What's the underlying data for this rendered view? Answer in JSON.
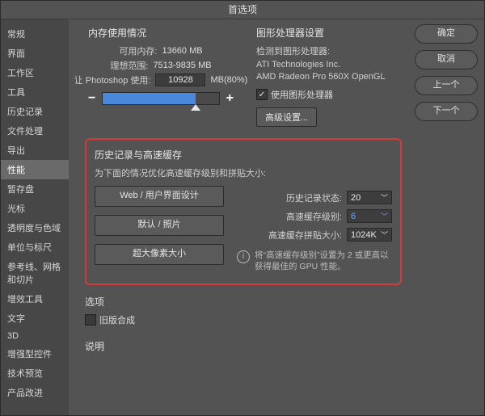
{
  "window": {
    "title": "首选项"
  },
  "buttons": {
    "ok": "确定",
    "cancel": "取消",
    "prev": "上一个",
    "next": "下一个"
  },
  "sidebar": {
    "items": [
      "常规",
      "界面",
      "工作区",
      "工具",
      "历史记录",
      "文件处理",
      "导出",
      "性能",
      "暂存盘",
      "光标",
      "透明度与色域",
      "单位与标尺",
      "参考线、网格和切片",
      "增效工具",
      "文字",
      "3D",
      "增强型控件",
      "技术预览",
      "产品改进"
    ],
    "selected_index": 7
  },
  "memory": {
    "section": "内存使用情况",
    "available_label": "可用内存:",
    "available_value": "13660 MB",
    "ideal_label": "理想范围:",
    "ideal_value": "7513-9835 MB",
    "let_ps_use": "让 Photoshop 使用:",
    "value": "10928",
    "unit_pct": "MB(80%)",
    "minus": "−",
    "plus": "+"
  },
  "gpu": {
    "section": "图形处理器设置",
    "detected_label": "检测到图形处理器:",
    "vendor": "ATI Technologies Inc.",
    "model": "AMD Radeon Pro 560X OpenGL",
    "use_gpu": "使用图形处理器",
    "advanced": "高级设置..."
  },
  "history": {
    "section": "历史记录与高速缓存",
    "optimize_label": "为下面的情况优化高速缓存级别和拼贴大小:",
    "preset_web": "Web / 用户界面设计",
    "preset_default": "默认 / 照片",
    "preset_huge": "超大像素大小",
    "states_label": "历史记录状态:",
    "states_value": "20",
    "levels_label": "高速缓存级别:",
    "levels_value": "6",
    "tile_label": "高速缓存拼贴大小:",
    "tile_value": "1024K",
    "hint": "将“高速缓存级别”设置为 2 或更高以获得最佳的 GPU 性能。"
  },
  "options": {
    "section": "选项",
    "legacy": "旧版合成"
  },
  "desc": {
    "section": "说明"
  }
}
